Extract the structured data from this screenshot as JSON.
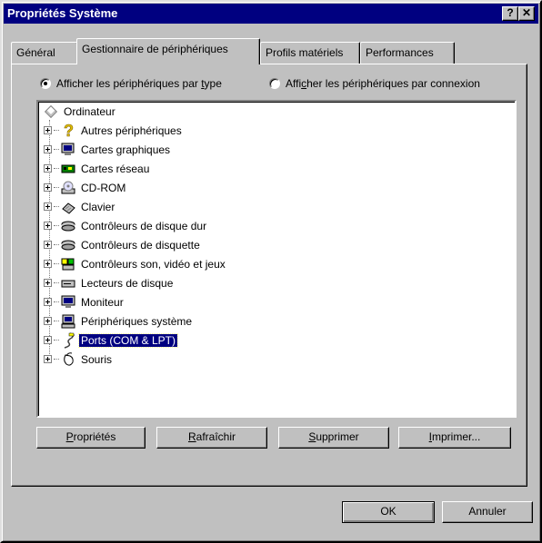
{
  "window": {
    "title": "Propriétés Système",
    "help_glyph": "?",
    "close_glyph": "✕"
  },
  "tabs": [
    {
      "label": "Général",
      "active": false
    },
    {
      "label": "Gestionnaire de périphériques",
      "active": true
    },
    {
      "label": "Profils matériels",
      "active": false
    },
    {
      "label": "Performances",
      "active": false
    }
  ],
  "view_options": {
    "by_type": {
      "pre": "Afficher les périphériques par ",
      "key": "t",
      "post": "ype",
      "selected": true
    },
    "by_connection": {
      "pre": "Affi",
      "key": "c",
      "post": "her les périphériques par connexion",
      "selected": false
    }
  },
  "tree": {
    "root": "Ordinateur",
    "items": [
      {
        "label": "Autres périphériques",
        "icon": "question-icon"
      },
      {
        "label": "Cartes graphiques",
        "icon": "display-adapter-icon"
      },
      {
        "label": "Cartes réseau",
        "icon": "network-card-icon"
      },
      {
        "label": "CD-ROM",
        "icon": "cdrom-icon"
      },
      {
        "label": "Clavier",
        "icon": "keyboard-icon"
      },
      {
        "label": "Contrôleurs de disque dur",
        "icon": "hard-disk-controller-icon"
      },
      {
        "label": "Contrôleurs de disquette",
        "icon": "floppy-controller-icon"
      },
      {
        "label": "Contrôleurs son, vidéo et jeux",
        "icon": "sound-video-game-icon"
      },
      {
        "label": "Lecteurs de disque",
        "icon": "disk-drive-icon"
      },
      {
        "label": "Moniteur",
        "icon": "monitor-icon"
      },
      {
        "label": "Périphériques système",
        "icon": "system-devices-icon"
      },
      {
        "label": "Ports (COM & LPT)",
        "icon": "port-icon",
        "selected": true
      },
      {
        "label": "Souris",
        "icon": "mouse-icon"
      }
    ]
  },
  "buttons": {
    "properties": {
      "key": "P",
      "rest": "ropriétés"
    },
    "refresh": {
      "key": "R",
      "rest": "afraîchir"
    },
    "remove": {
      "key": "S",
      "rest": "upprimer"
    },
    "print": {
      "key": "I",
      "rest": "mprimer..."
    },
    "ok": "OK",
    "cancel": "Annuler"
  },
  "colors": {
    "titlebar": "#000080",
    "face": "#c0c0c0",
    "selection": "#000080"
  }
}
